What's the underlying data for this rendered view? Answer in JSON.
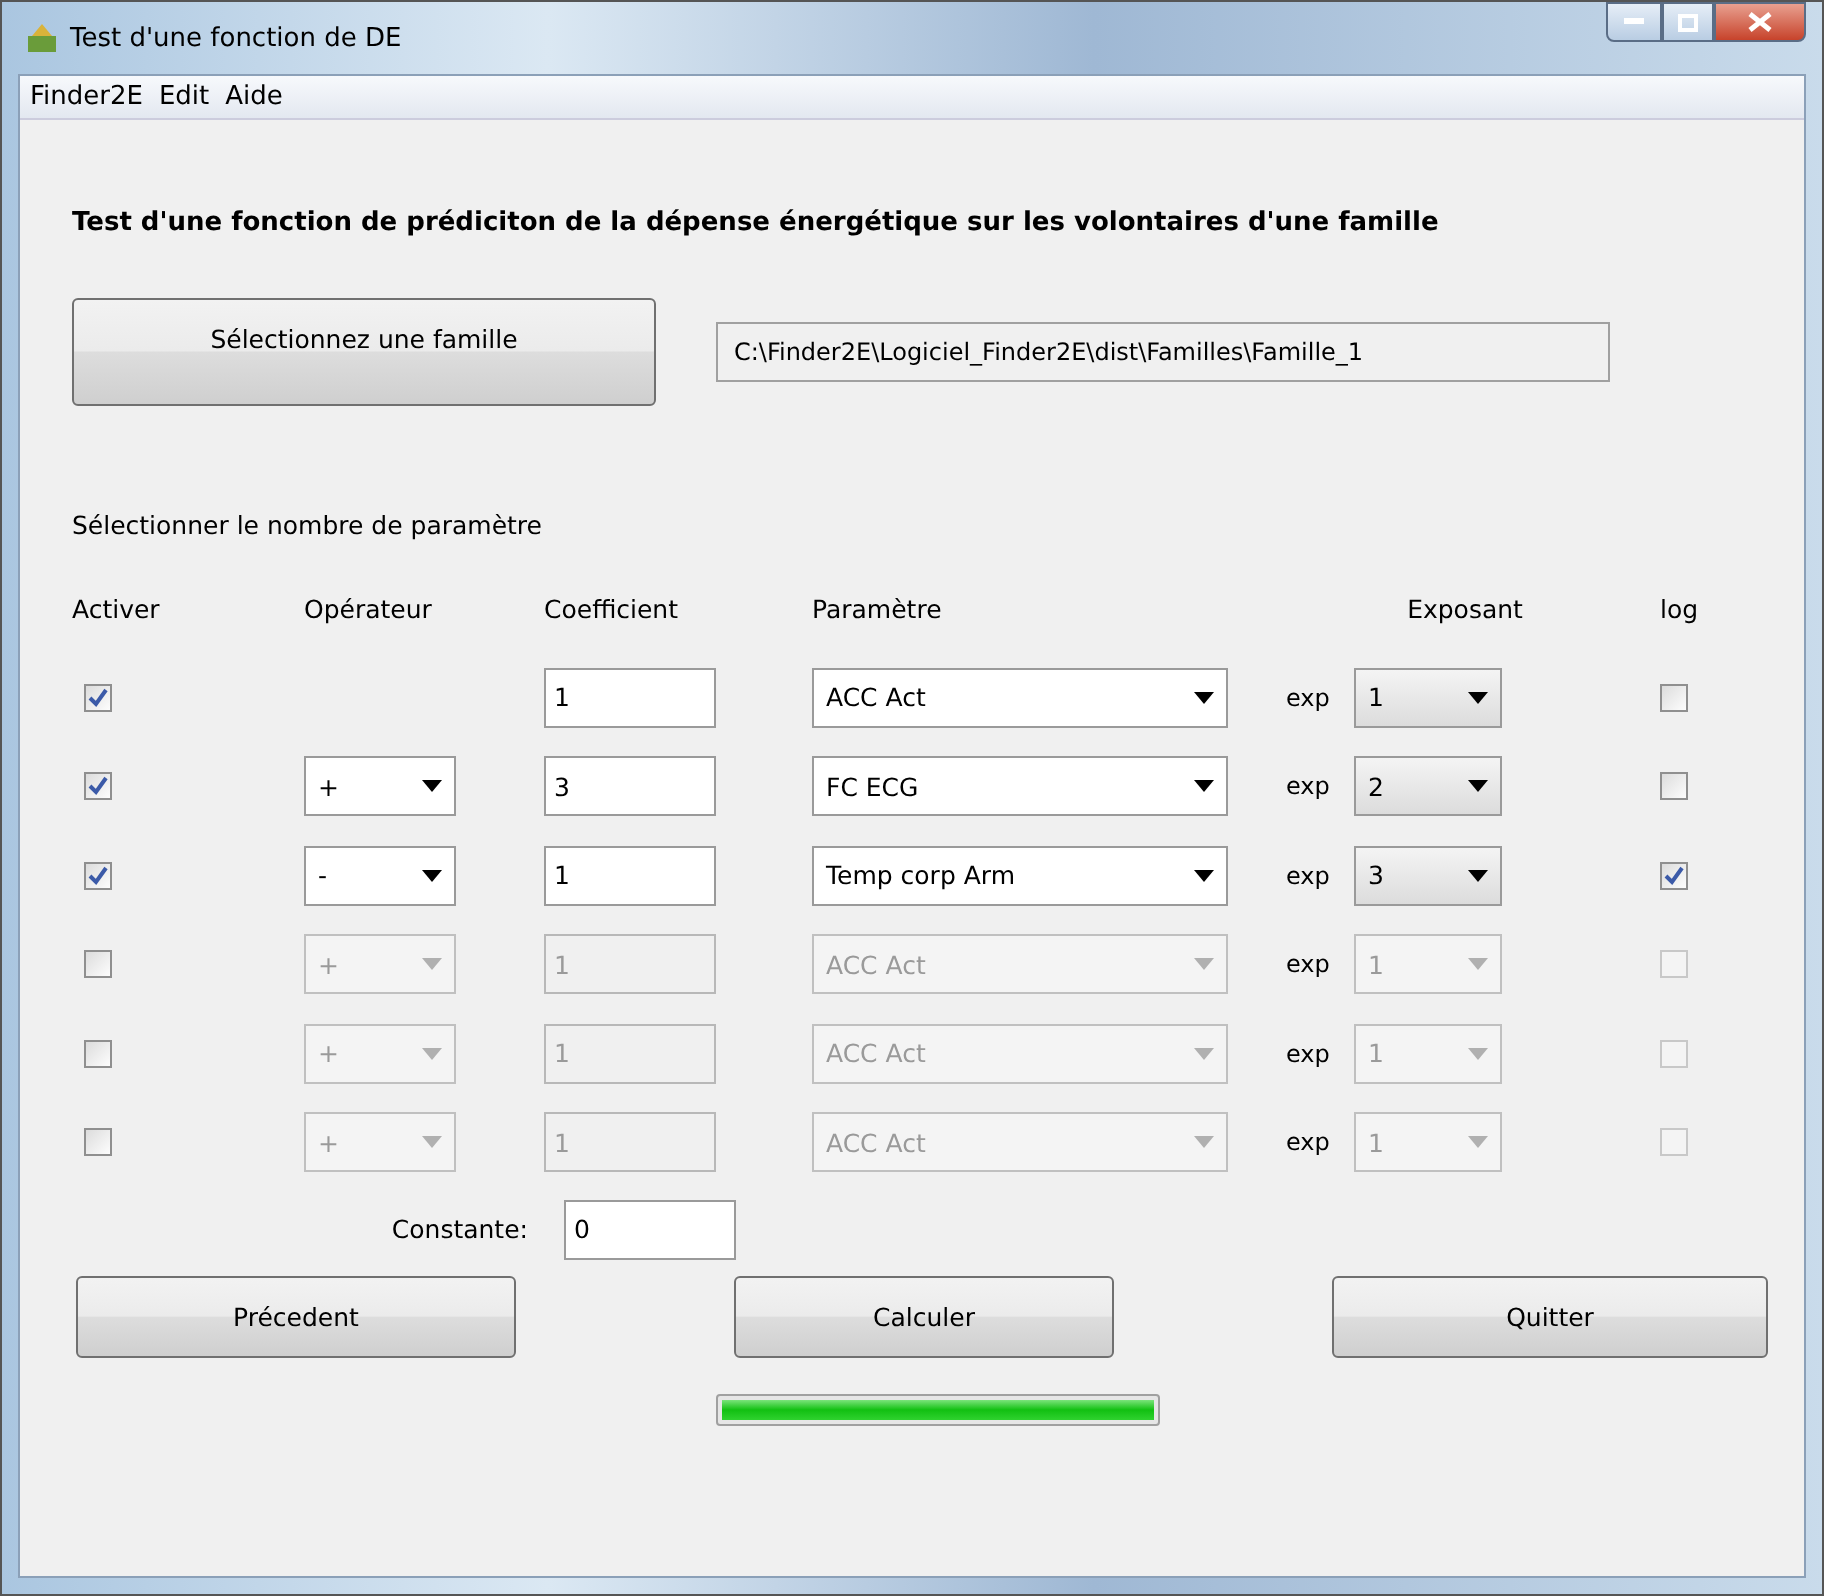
{
  "window": {
    "title": "Test d'une fonction de DE"
  },
  "menu": [
    "Finder2E",
    "Edit",
    "Aide"
  ],
  "heading": "Test d'une fonction de prédiciton de la dépense énergétique sur les volontaires d'une famille",
  "select_family_button": "Sélectionnez une famille",
  "family_path": "C:\\Finder2E\\Logiciel_Finder2E\\dist\\Familles\\Famille_1",
  "parameter_count_label": "Sélectionner le nombre de paramètre",
  "columns": [
    "Activer",
    "Opérateur",
    "Coefficient",
    "Paramètre",
    "Exposant",
    "log"
  ],
  "rows": [
    {
      "active": true,
      "coefficient": "1",
      "parameter": "ACC Act",
      "exp_label": "exp",
      "exponent": "1",
      "log": false
    },
    {
      "active": true,
      "operator": "+",
      "coefficient": "3",
      "parameter": "FC ECG",
      "exp_label": "exp",
      "exponent": "2",
      "log": false
    },
    {
      "active": true,
      "operator": "-",
      "coefficient": "1",
      "parameter": "Temp corp Arm",
      "exp_label": "exp",
      "exponent": "3",
      "log": true
    },
    {
      "active": false,
      "operator": "+",
      "coefficient": "1",
      "parameter": "ACC Act",
      "exp_label": "exp",
      "exponent": "1",
      "log": false
    },
    {
      "active": false,
      "operator": "+",
      "coefficient": "1",
      "parameter": "ACC Act",
      "exp_label": "exp",
      "exponent": "1",
      "log": false
    },
    {
      "active": false,
      "operator": "+",
      "coefficient": "1",
      "parameter": "ACC Act",
      "exp_label": "exp",
      "exponent": "1",
      "log": false
    }
  ],
  "constant": {
    "label": "Constante:",
    "value": "0"
  },
  "buttons": [
    "Précedent",
    "Calculer",
    "Quitter"
  ],
  "progress": {
    "level": 1.0
  }
}
